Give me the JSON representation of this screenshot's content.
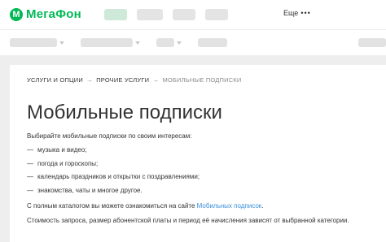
{
  "brand": {
    "logo_mark": "М",
    "name": "МегаФон",
    "color": "#00b956"
  },
  "header": {
    "more_label": "Еще",
    "more_icon": "•••"
  },
  "breadcrumb": {
    "items": [
      "Услуги и опции",
      "Прочие услуги"
    ],
    "current": "Мобильные подписки",
    "separator": "→"
  },
  "page": {
    "title": "Мобильные подписки",
    "lead": "Выбирайте мобильные подписки по своим интересам:",
    "list": [
      "музыка и видео;",
      "погода и гороскопы;",
      "календарь праздников и открытки с поздравлениями;",
      "знакомства, чаты и многое другое."
    ],
    "catalog_prefix": "С полным каталогом вы можете ознакомиться на сайте ",
    "catalog_link": "Мобильных подписок",
    "catalog_suffix": ".",
    "cost_note": "Стоимость запроса, размер абонентской платы и период её начисления зависят от выбранной категории."
  },
  "colors": {
    "link": "#3a8fd9",
    "background": "#eeeeee",
    "card": "#ffffff"
  }
}
